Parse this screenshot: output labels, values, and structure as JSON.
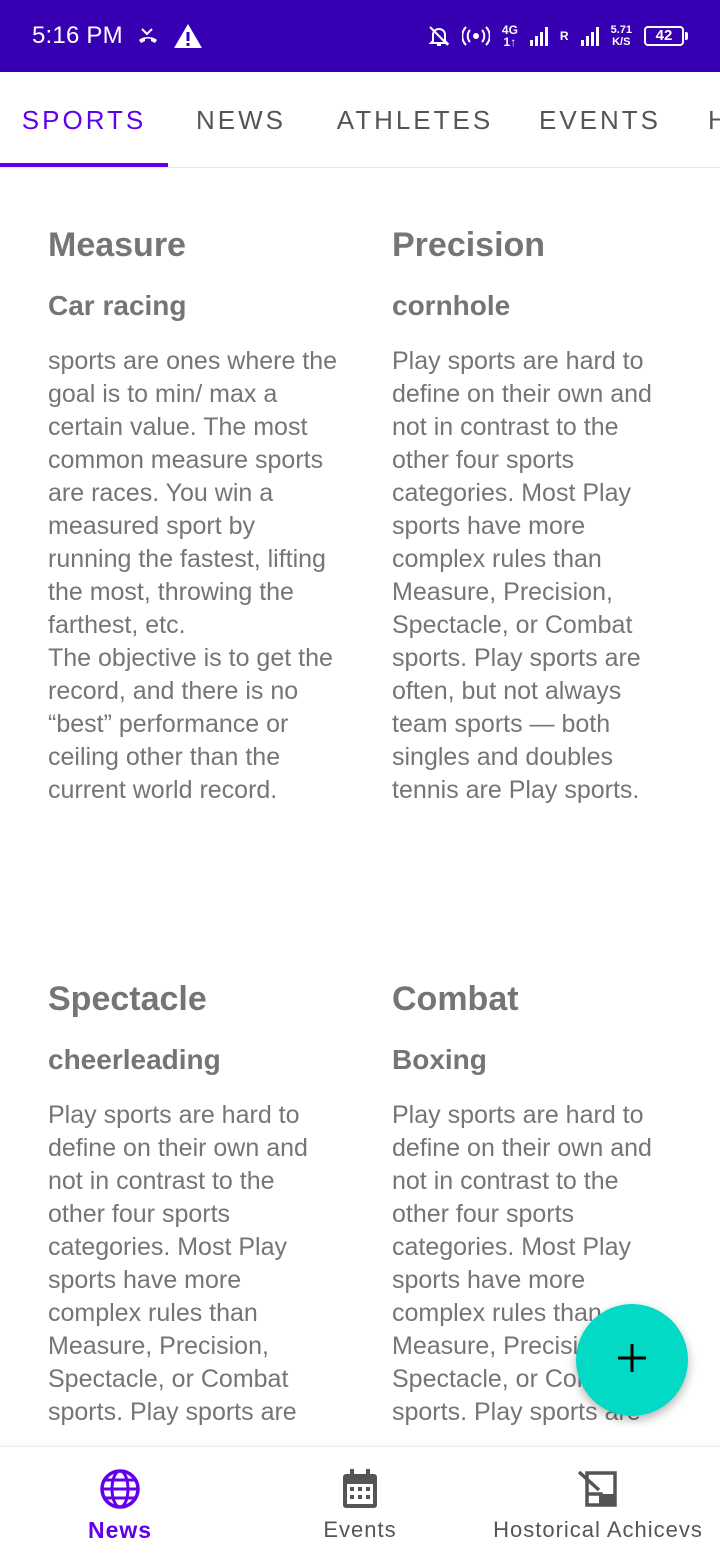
{
  "status_bar": {
    "time": "5:16 PM",
    "network_top": "4G",
    "network_bottom": "1↑",
    "roaming": "R",
    "speed_value": "5.71",
    "speed_unit": "K/S",
    "battery": "42",
    "background_color": "#3700b3",
    "icons": [
      "missed-call-icon",
      "warning-icon",
      "mute-bell-icon",
      "hotspot-icon",
      "signal-icon",
      "signal-roaming-icon",
      "battery-icon"
    ]
  },
  "tabs": [
    {
      "label": "SPORTS",
      "active": true
    },
    {
      "label": "NEWS",
      "active": false
    },
    {
      "label": "ATHLETES",
      "active": false
    },
    {
      "label": "EVENTS",
      "active": false
    },
    {
      "label": "H",
      "active": false
    }
  ],
  "cards": [
    {
      "title": "Measure",
      "subtitle": "Car racing",
      "body": "sports are ones where the goal is to min/ max a certain value. The most common measure sports are races. You win a measured sport by running the fastest, lifting the most, throwing the farthest, etc.\n The objective is to get the record, and there is no “best” performance or ceiling other than the current world record."
    },
    {
      "title": "Precision",
      "subtitle": "cornhole",
      "body": "Play sports are hard to define on their own and not in contrast to the other four sports categories. Most Play sports have more complex rules than Measure, Precision, Spectacle, or Combat sports. Play sports are often, but not always team sports — both singles and doubles tennis are Play sports."
    },
    {
      "title": "Spectacle",
      "subtitle": "cheerleading",
      "body": "Play sports are hard to define on their own and not in contrast to the other four sports categories. Most Play sports have more complex rules than Measure, Precision, Spectacle, or Combat sports. Play sports are"
    },
    {
      "title": "Combat",
      "subtitle": "Boxing",
      "body": "Play sports are hard to define on their own and not in contrast to the other four sports categories. Most Play sports have more complex rules than Measure, Precision, Spectacle, or Combat sports. Play sports are"
    }
  ],
  "fab": {
    "icon": "plus-icon",
    "color": "#03dac5"
  },
  "bottom_nav": [
    {
      "label": "News",
      "icon": "globe-icon",
      "active": true
    },
    {
      "label": "Events",
      "icon": "calendar-icon",
      "active": false
    },
    {
      "label": "Hostorical Achicevs",
      "icon": "history-icon",
      "active": false
    }
  ],
  "colors": {
    "primary": "#6200ee",
    "primary_dark": "#3700b3",
    "accent": "#03dac5",
    "text_gray": "#757575"
  }
}
